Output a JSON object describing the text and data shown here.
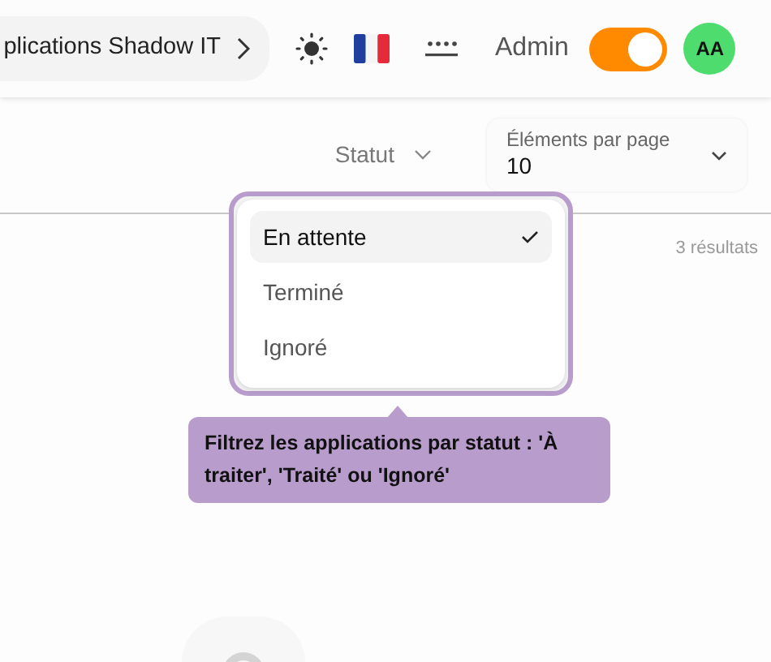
{
  "header": {
    "breadcrumb": "plications Shadow IT",
    "user_label": "Admin",
    "admin_toggle": {
      "on": true
    },
    "avatar": "AA"
  },
  "toolbar": {
    "status_filter": {
      "label": "Statut"
    },
    "page_size": {
      "label": "Éléments par page",
      "value": "10"
    }
  },
  "results_count": "3 résultats",
  "status_menu": {
    "options": [
      {
        "label": "En attente",
        "selected": true
      },
      {
        "label": "Terminé",
        "selected": false
      },
      {
        "label": "Ignoré",
        "selected": false
      }
    ]
  },
  "tooltip": "Filtrez les applications par statut : 'À traiter', 'Traité' ou 'Ignoré'"
}
